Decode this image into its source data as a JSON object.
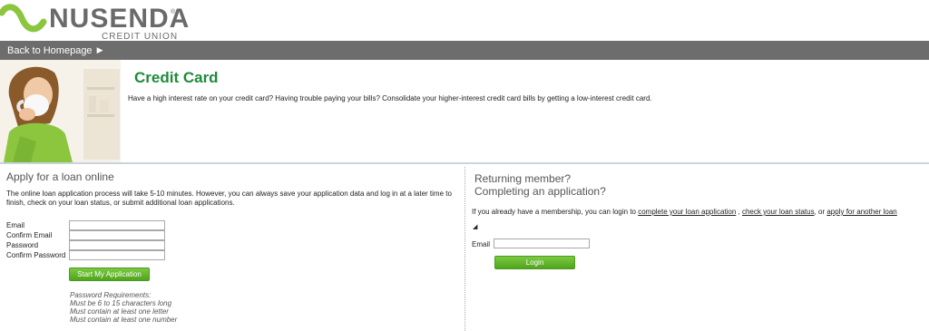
{
  "header": {
    "logo_name": "NUSENDA",
    "logo_registered": "®",
    "logo_subtitle": "CREDIT UNION"
  },
  "nav": {
    "back_label": "Back to Homepage",
    "back_icon": "triangle-right-icon"
  },
  "hero": {
    "title": "Credit Card",
    "description": "Have a high interest rate on your credit card?  Having trouble paying your bills?  Consolidate your higher-interest credit card bills by getting a low-interest credit card."
  },
  "apply": {
    "heading": "Apply for a loan online",
    "intro": "The online loan application process will take 5-10 minutes. However, you can always save your application data and log in at a later time to finish, check on your loan status, or submit additional loan applications.",
    "fields": {
      "email_label": "Email",
      "confirm_email_label": "Confirm Email",
      "password_label": "Password",
      "confirm_password_label": "Confirm Password"
    },
    "start_button": "Start My Application",
    "password_requirements": {
      "title": "Password Requirements:",
      "rules": [
        "Must be 6 to 15 characters long",
        "Must contain at least one letter",
        "Must contain at least one number"
      ]
    }
  },
  "returning": {
    "heading_line1": "Returning member?",
    "heading_line2": "Completing an application?",
    "text_prefix": "If you already have a membership, you can login to ",
    "link_complete": "complete your loan application",
    "sep1": " , ",
    "link_status": "check your loan status",
    "sep2": ", or ",
    "link_another": "apply for another loan",
    "toggle_icon": "triangle-down-icon",
    "email_label": "Email",
    "login_button": "Login"
  },
  "colors": {
    "brand_green": "#1e8a3a",
    "button_green": "#5fb12a",
    "nav_gray": "#6d6d6d",
    "logo_wave": "#8cc63f"
  }
}
